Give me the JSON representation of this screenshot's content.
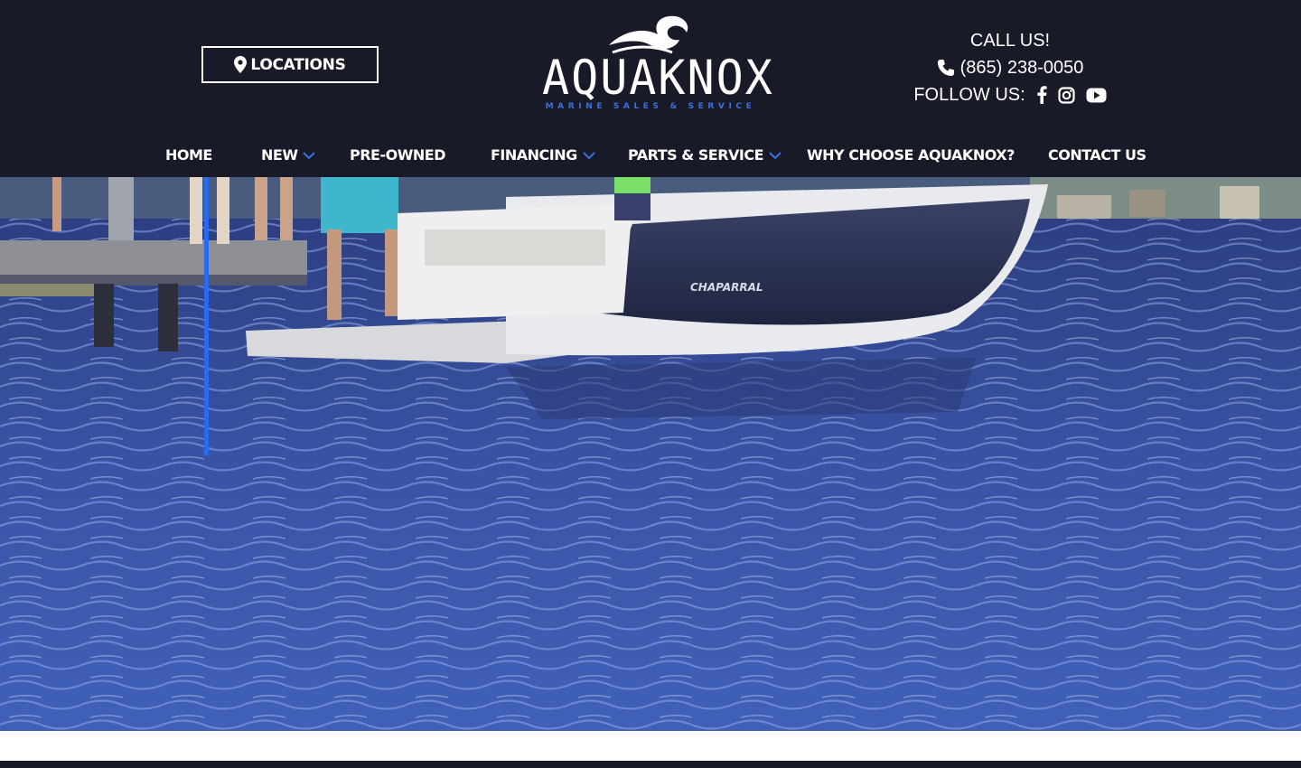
{
  "header": {
    "locations_label": "LOCATIONS",
    "logo": {
      "wordmark": "AQUAKNOX",
      "tagline": "MARINE SALES & SERVICE"
    },
    "contact": {
      "call_label": "CALL US!",
      "phone": "(865) 238-0050",
      "follow_label": "FOLLOW US:",
      "social_icons": [
        "facebook-icon",
        "instagram-icon",
        "youtube-icon"
      ]
    }
  },
  "nav": {
    "items": [
      {
        "label": "HOME",
        "dropdown": false
      },
      {
        "label": "NEW",
        "dropdown": true
      },
      {
        "label": "PRE-OWNED",
        "dropdown": false
      },
      {
        "label": "FINANCING",
        "dropdown": true
      },
      {
        "label": "PARTS & SERVICE",
        "dropdown": true
      },
      {
        "label": "WHY CHOOSE AQUAKNOX?",
        "dropdown": false
      },
      {
        "label": "CONTACT US",
        "dropdown": false
      }
    ]
  },
  "hero": {
    "boat_brand": "CHAPARRAL"
  },
  "colors": {
    "header_bg": "#181a27",
    "accent": "#3c6fe0",
    "water": "#3b4f96"
  }
}
